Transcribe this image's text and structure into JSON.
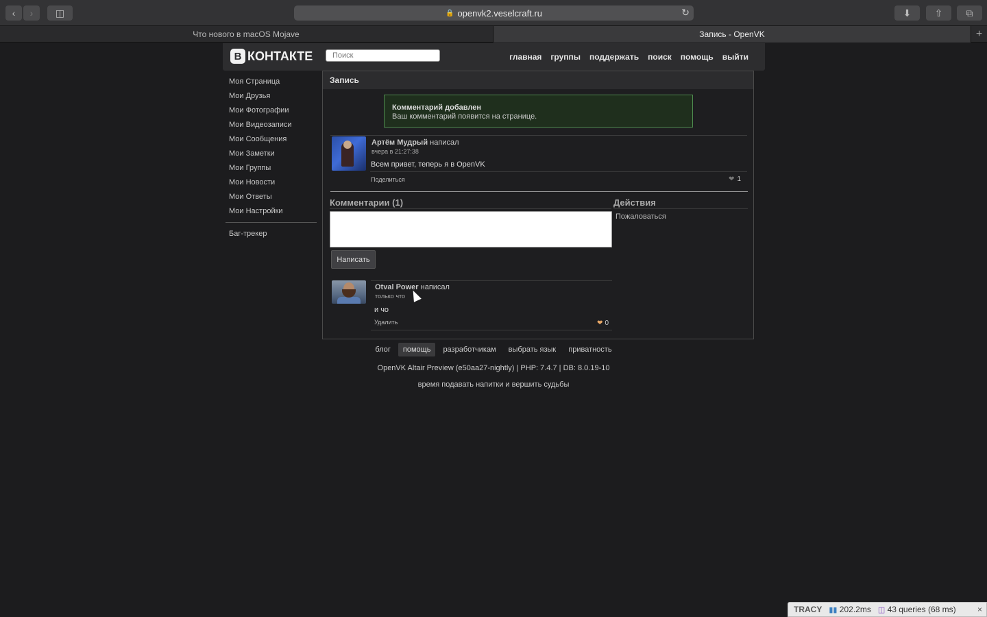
{
  "browser": {
    "url": "openvk2.veselcraft.ru",
    "tabs": [
      {
        "title": "Что нового в macOS Mojave",
        "active": false
      },
      {
        "title": "Запись - OpenVK",
        "active": true
      }
    ]
  },
  "header": {
    "logo_mark": "В",
    "logo_text": "КОНТАКТЕ",
    "search_placeholder": "Поиск",
    "nav": [
      "главная",
      "группы",
      "поддержать",
      "поиск",
      "помощь",
      "выйти"
    ]
  },
  "sidebar": {
    "items": [
      "Моя Страница",
      "Мои Друзья",
      "Мои Фотографии",
      "Мои Видеозаписи",
      "Мои Сообщения",
      "Мои Заметки",
      "Мои Группы",
      "Мои Новости",
      "Мои Ответы",
      "Мои Настройки"
    ],
    "extra": "Баг-трекер"
  },
  "main": {
    "title": "Запись",
    "notice": {
      "title": "Комментарий добавлен",
      "text": "Ваш комментарий появится на странице."
    },
    "post": {
      "author": "Артём Мудрый",
      "verb": "написал",
      "date": "вчера в 21:27:38",
      "text": "Всем привет, теперь я в OpenVK",
      "share_label": "Поделиться",
      "likes": "1"
    },
    "comments_heading": "Комментарии (1)",
    "actions_heading": "Действия",
    "report_label": "Пожаловаться",
    "submit_label": "Написать",
    "comment": {
      "author": "Otval Power",
      "verb": "написал",
      "date": "только что",
      "text": "и чо",
      "delete_label": "Удалить",
      "likes": "0"
    }
  },
  "footer": {
    "links": [
      "блог",
      "помощь",
      "разработчикам",
      "выбрать язык",
      "приватность"
    ],
    "active_link": "помощь",
    "version": "OpenVK Altair Preview (e50aa27-nightly) | PHP: 7.4.7 | DB: 8.0.19-10",
    "slogan": "время подавать напитки и вершить судьбы"
  },
  "tracy": {
    "brand": "TRACY",
    "time": "202.2ms",
    "queries": "43 queries (68 ms)",
    "close": "×"
  },
  "colors": {
    "background": "#1c1c1e",
    "notice_border": "#4e8b4e",
    "heart": "#e8a867"
  }
}
